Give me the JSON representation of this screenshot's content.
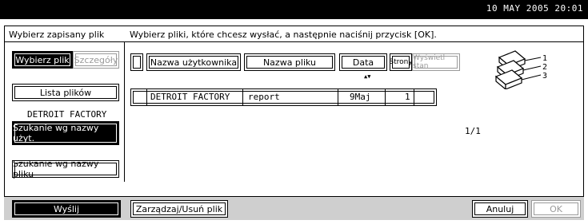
{
  "clock": "10 MAY  2005 20:01",
  "left_header": "Wybierz zapisany plik",
  "right_header": "Wybierz pliki, które chcesz wysłać, a następnie naciśnij przycisk [OK].",
  "left_tabs": {
    "select": "Wybierz plik",
    "search": "Szczegóły"
  },
  "file_list_button": "Lista plików",
  "location_label": "DETROIT FACTORY",
  "search_by_user": "Szukanie wg nazwy użyt.",
  "search_by_file": "Szukanie wg nazwy pliku",
  "columns": {
    "user": "Nazwa użytkownika",
    "file": "Nazwa pliku",
    "date": "Data",
    "pages": "Strony",
    "preview": "Wyświetl stan"
  },
  "sort_indicator": "▲▼",
  "rows": [
    {
      "user": "DETROIT FACTORY",
      "file": "report",
      "date": "9Maj",
      "pages": "1"
    }
  ],
  "pager": "1/1",
  "stack_labels": [
    "1",
    "2",
    "3"
  ],
  "bottom": {
    "send": "Wyślij",
    "manage": "Zarządzaj/Usuń plik",
    "cancel": "Anuluj",
    "ok": "OK"
  }
}
